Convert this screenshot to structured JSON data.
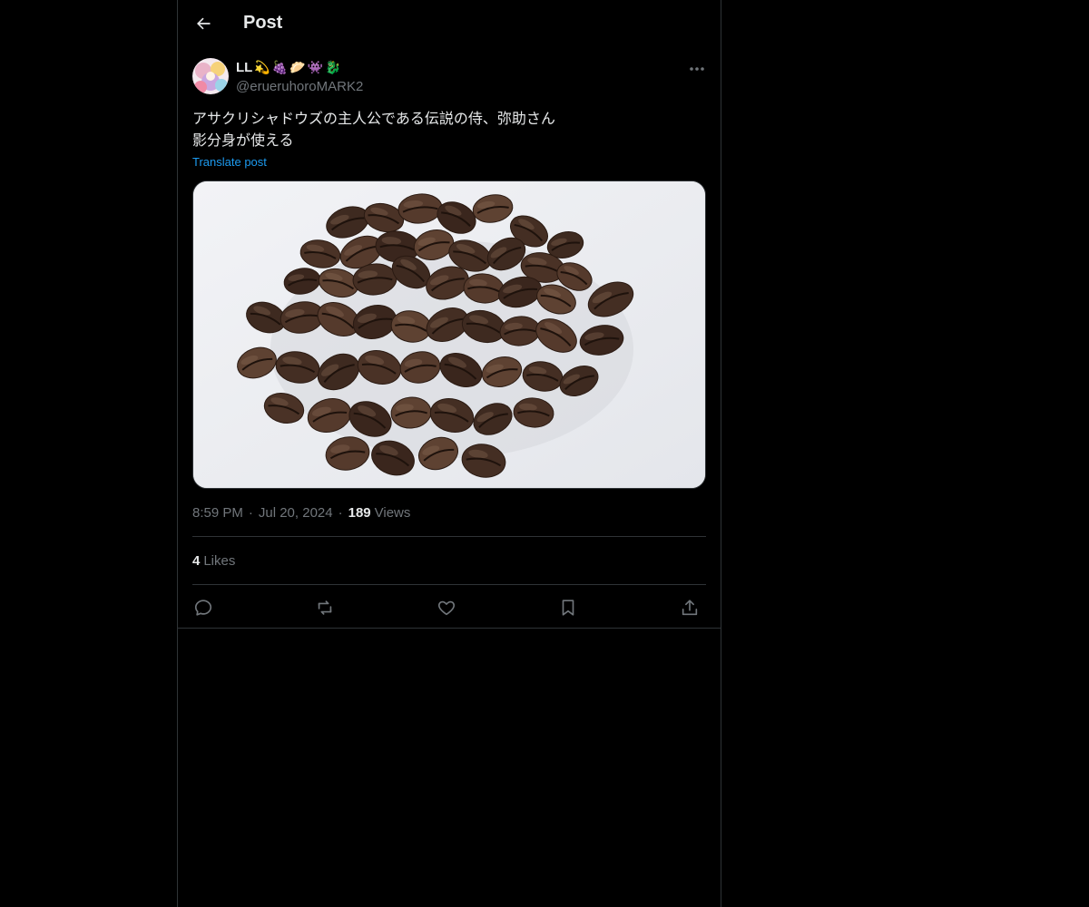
{
  "header": {
    "title": "Post",
    "back_icon": "arrow-left-icon"
  },
  "author": {
    "display_name": "LL",
    "name_emojis": [
      "💫",
      "🍇",
      "🥟",
      "👾",
      "🐉"
    ],
    "handle": "@erueruhoroMARK2"
  },
  "post": {
    "text_lines": [
      "アサクリシャドウズの主人公である伝説の侍、弥助さん",
      "影分身が使える"
    ],
    "translate_label": "Translate post",
    "image_alt": "coffee beans on white background"
  },
  "meta": {
    "time": "8:59 PM",
    "date": "Jul 20, 2024",
    "separator": "·",
    "views_count": "189",
    "views_label": "Views"
  },
  "stats": {
    "likes_count": "4",
    "likes_label": "Likes"
  },
  "actions": [
    "reply-icon",
    "repost-icon",
    "like-icon",
    "bookmark-icon",
    "share-icon"
  ],
  "colors": {
    "background": "#000000",
    "border": "#2f3336",
    "link": "#1d9bf0",
    "muted": "#71767b",
    "text": "#e7e9ea"
  }
}
